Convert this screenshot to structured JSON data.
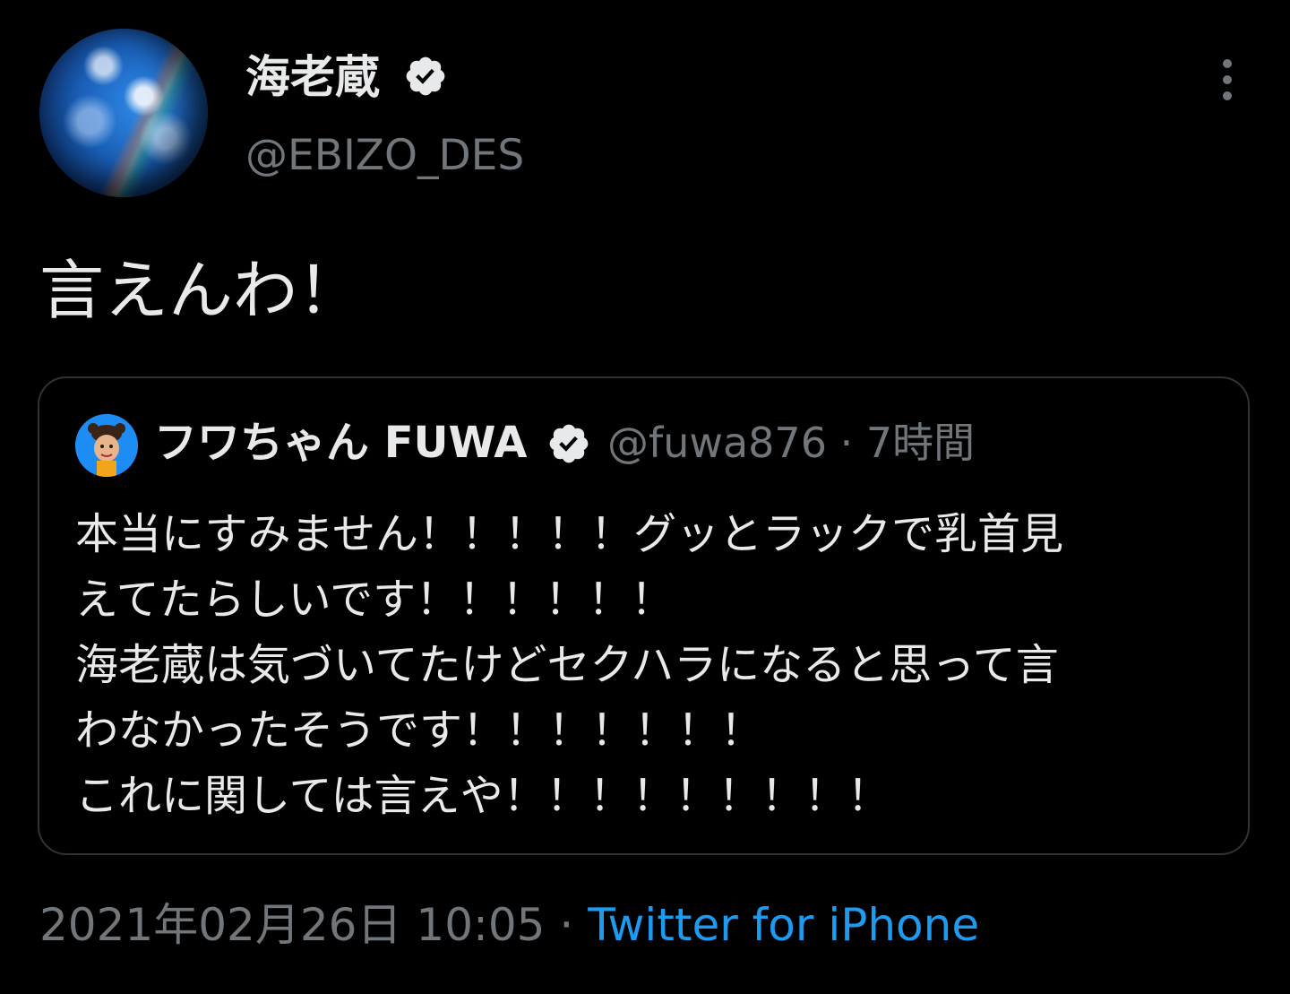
{
  "author": {
    "display_name": "海老蔵",
    "handle": "@EBIZO_DES",
    "avatar_icon": "earth-globe-avatar",
    "verified_icon": "verified-badge-icon"
  },
  "tweet": {
    "text": "言えんわ！"
  },
  "quoted_tweet": {
    "display_name": "フワちゃん FUWA",
    "handle": "@fuwa876",
    "separator": "·",
    "time": "7時間",
    "avatar_icon": "fuwa-avatar",
    "verified_icon": "verified-badge-icon",
    "lines": [
      "本当にすみません！！！！！グッとラックで乳首見",
      "えてたらしいです！！！！！！",
      "海老蔵は気づいてたけどセクハラになると思って言",
      "わなかったそうです！！！！！！！",
      "これに関しては言えや！！！！！！！！！"
    ]
  },
  "footer": {
    "timestamp": "2021年02月26日 10:05",
    "separator": "·",
    "source": "Twitter for iPhone"
  },
  "menu": {
    "icon": "more-vertical-icon"
  },
  "colors": {
    "background": "#000000",
    "primary_text": "#e7e9ea",
    "secondary_text": "#71767b",
    "link": "#1d9bf0",
    "border": "#2f3336"
  }
}
